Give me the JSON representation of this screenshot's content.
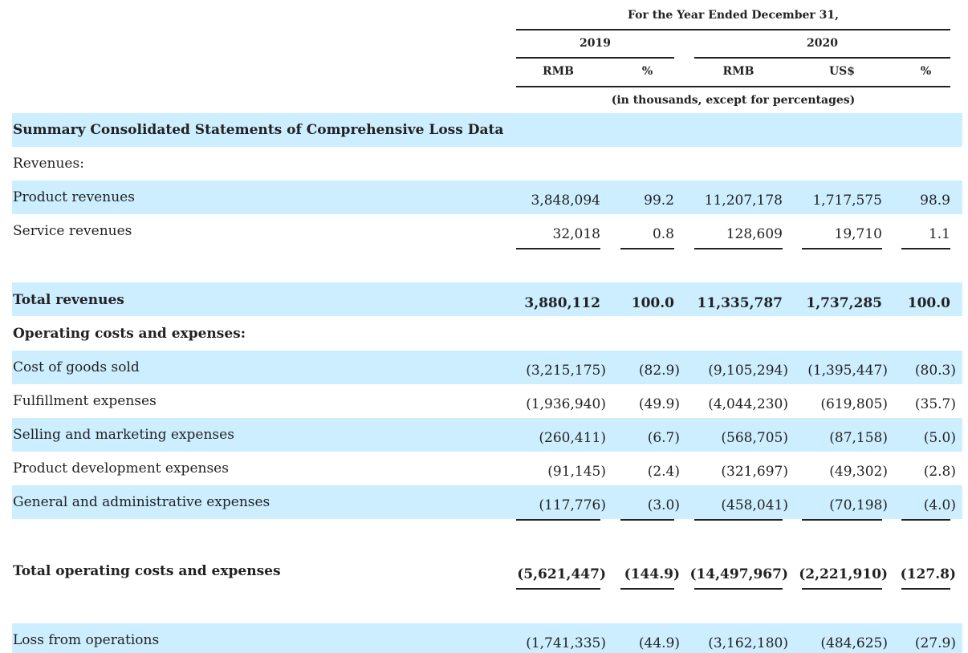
{
  "header": {
    "period": "For the Year Ended December 31,",
    "year_2019": "2019",
    "year_2020": "2020",
    "col_rmb_2019": "RMB",
    "col_pct_2019": "%",
    "col_rmb_2020": "RMB",
    "col_usd_2020": "US$",
    "col_pct_2020": "%",
    "units_note": "(in thousands, except for percentages)"
  },
  "section_title": "Summary Consolidated Statements of Comprehensive Loss Data",
  "revenues_heading": "Revenues:",
  "rows": {
    "product_revenues": {
      "label": "Product revenues",
      "rmb2019": "3,848,094",
      "pct2019": "99.2",
      "rmb2020": "11,207,178",
      "usd2020": "1,717,575",
      "pct2020": "98.9"
    },
    "service_revenues": {
      "label": "Service revenues",
      "rmb2019": "32,018",
      "pct2019": "0.8",
      "rmb2020": "128,609",
      "usd2020": "19,710",
      "pct2020": "1.1"
    },
    "total_revenues": {
      "label": "Total revenues",
      "rmb2019": "3,880,112",
      "pct2019": "100.0",
      "rmb2020": "11,335,787",
      "usd2020": "1,737,285",
      "pct2020": "100.0"
    },
    "cost_of_goods_sold": {
      "label": "Cost of goods sold",
      "rmb2019": "(3,215,175)",
      "pct2019": "(82.9)",
      "rmb2020": "(9,105,294)",
      "usd2020": "(1,395,447)",
      "pct2020": "(80.3)"
    },
    "fulfillment": {
      "label": "Fulfillment expenses",
      "rmb2019": "(1,936,940)",
      "pct2019": "(49.9)",
      "rmb2020": "(4,044,230)",
      "usd2020": "(619,805)",
      "pct2020": "(35.7)"
    },
    "selling_marketing": {
      "label": "Selling and marketing expenses",
      "rmb2019": "(260,411)",
      "pct2019": "(6.7)",
      "rmb2020": "(568,705)",
      "usd2020": "(87,158)",
      "pct2020": "(5.0)"
    },
    "product_development": {
      "label": "Product development expenses",
      "rmb2019": "(91,145)",
      "pct2019": "(2.4)",
      "rmb2020": "(321,697)",
      "usd2020": "(49,302)",
      "pct2020": "(2.8)"
    },
    "general_admin": {
      "label": "General and administrative expenses",
      "rmb2019": "(117,776)",
      "pct2019": "(3.0)",
      "rmb2020": "(458,041)",
      "usd2020": "(70,198)",
      "pct2020": "(4.0)"
    },
    "total_opex": {
      "label": "Total operating costs and expenses",
      "rmb2019": "(5,621,447)",
      "pct2019": "(144.9)",
      "rmb2020": "(14,497,967)",
      "usd2020": "(2,221,910)",
      "pct2020": "(127.8)"
    },
    "loss_from_operations": {
      "label": "Loss from operations",
      "rmb2019": "(1,741,335)",
      "pct2019": "(44.9)",
      "rmb2020": "(3,162,180)",
      "usd2020": "(484,625)",
      "pct2020": "(27.9)"
    }
  },
  "opex_heading": "Operating costs and expenses:",
  "colors": {
    "band": "#cceeff",
    "text": "#222222"
  }
}
